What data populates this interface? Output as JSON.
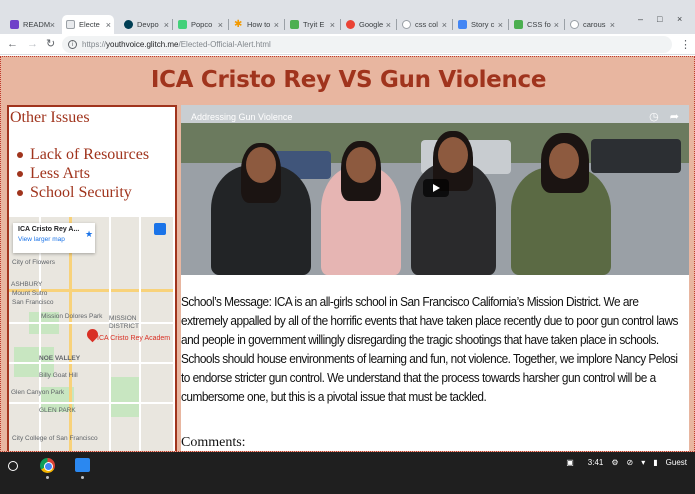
{
  "browser": {
    "tabs": [
      {
        "title": "READM",
        "icon": "github-icon",
        "color": "#6e40c9"
      },
      {
        "title": "Electe",
        "icon": "page-icon",
        "color": "#9aa0a6",
        "active": true
      },
      {
        "title": "Devpo",
        "icon": "devpost-icon",
        "color": "#003e54"
      },
      {
        "title": "Popco",
        "icon": "popcorn-icon",
        "color": "#43d17a"
      },
      {
        "title": "How to",
        "icon": "asterisk-icon",
        "color": "#f29900"
      },
      {
        "title": "Tryit E",
        "icon": "w3-icon",
        "color": "#4caf50"
      },
      {
        "title": "Google",
        "icon": "google-icon",
        "color": "#ea4335"
      },
      {
        "title": "css col",
        "icon": "google-g-icon",
        "color": "#9aa0a6"
      },
      {
        "title": "Story c",
        "icon": "doc-icon",
        "color": "#4285f4"
      },
      {
        "title": "CSS fo",
        "icon": "w3-icon",
        "color": "#4caf50"
      },
      {
        "title": "carous",
        "icon": "google-g-icon",
        "color": "#9aa0a6"
      }
    ],
    "url": {
      "scheme": "https://",
      "host": "youthvoice.glitch.me",
      "path": "/Elected-Official-Alert.html"
    }
  },
  "page": {
    "title": "ICA Cristo Rey VS Gun Violence",
    "sidebar": {
      "heading": "Other Issues",
      "issues": [
        "Lack of Resources",
        "Less Arts",
        "School Security"
      ]
    },
    "map": {
      "card_name": "ICA Cristo Rey A...",
      "card_link": "View larger map",
      "pin_label": "ICA Cristo Rey Academ",
      "labels": [
        "City of Flowers",
        "ASHBURY",
        "Mount Sutro",
        "Mount Sutro",
        "San Francisco",
        "MISSION",
        "DISTRICT",
        "Billy Goat Hill",
        "NOE VALLEY",
        "Glen Canyon Park",
        "GLEN PARK",
        "City College of San Francisco",
        "Mission Dolores Park"
      ]
    },
    "video": {
      "title": "Addressing Gun Violence"
    },
    "message": "School’s Message: ICA is an all-girls school in San Francisco California’s Mission District. We are extremely appalled by all of the horrific events that have taken place recently due to poor gun control laws and people in government willingly disregarding the tragic shootings that have taken place in schools. Schools should house environments of learning and fun, not violence. Together, we implore Nancy Pelosi to endorse stricter gun control. We understand that the process towards harsher gun control will be a cumbersome one, but this is a pivotal issue that must be tackled.",
    "comments_label": "Comments:"
  },
  "taskbar": {
    "time": "3:41",
    "user": "Guest"
  },
  "colors": {
    "accent": "#a0341d",
    "page_bg": "#e8b6a0"
  }
}
